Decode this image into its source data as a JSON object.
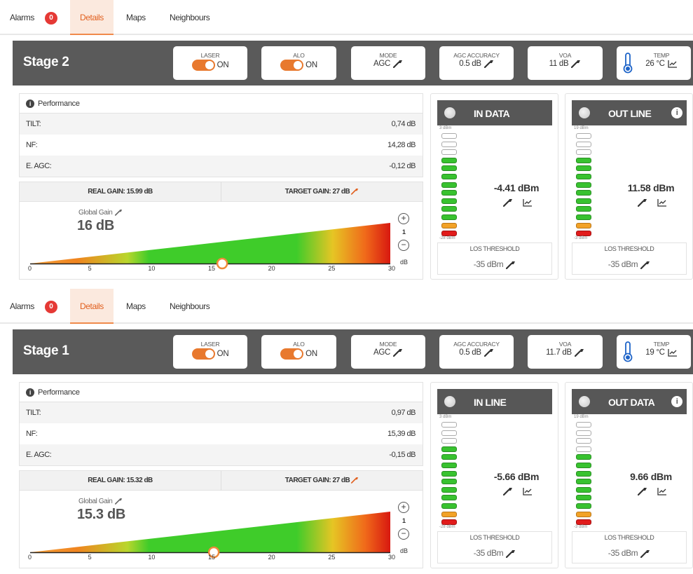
{
  "panels": [
    {
      "tabs": {
        "alarms": "Alarms",
        "alarm_count": "0",
        "details": "Details",
        "maps": "Maps",
        "neighbours": "Neighbours"
      },
      "stage": {
        "title": "Stage 2",
        "laser": {
          "label": "LASER",
          "value": "ON"
        },
        "alo": {
          "label": "ALO",
          "value": "ON"
        },
        "mode": {
          "label": "MODE",
          "value": "AGC"
        },
        "agc_accuracy": {
          "label": "AGC ACCURACY",
          "value": "0.5 dB"
        },
        "voa": {
          "label": "VOA",
          "value": "11 dB"
        },
        "temp": {
          "label": "TEMP",
          "value": "26 °C"
        }
      },
      "performance": {
        "title": "Performance",
        "rows": [
          {
            "label": "TILT:",
            "value": "0,74 dB"
          },
          {
            "label": "NF:",
            "value": "14,28 dB"
          },
          {
            "label": "E. AGC:",
            "value": "-0,12 dB"
          }
        ]
      },
      "gain": {
        "real": "REAL GAIN: 15.99 dB",
        "target": "TARGET GAIN: 27 dB",
        "global_label": "Global Gain",
        "global_value": "16 dB",
        "step": "1",
        "unit": "dB",
        "ticks": [
          "0",
          "5",
          "10",
          "15",
          "20",
          "25",
          "30"
        ],
        "knob_value": 16
      },
      "meters": [
        {
          "title": "IN DATA",
          "scale_top": "3 dBm",
          "scale_bottom": "-28 dBm",
          "reading": "-4.41 dBm",
          "los_label": "LOS THRESHOLD",
          "los_value": "-35 dBm",
          "info": false,
          "level": 10
        },
        {
          "title": "OUT LINE",
          "scale_top": "19 dBm",
          "scale_bottom": "-3 dBm",
          "reading": "11.58 dBm",
          "los_label": "LOS THRESHOLD",
          "los_value": "-35 dBm",
          "info": true,
          "level": 10
        }
      ]
    },
    {
      "tabs": {
        "alarms": "Alarms",
        "alarm_count": "0",
        "details": "Details",
        "maps": "Maps",
        "neighbours": "Neighbours"
      },
      "stage": {
        "title": "Stage 1",
        "laser": {
          "label": "LASER",
          "value": "ON"
        },
        "alo": {
          "label": "ALO",
          "value": "ON"
        },
        "mode": {
          "label": "MODE",
          "value": "AGC"
        },
        "agc_accuracy": {
          "label": "AGC ACCURACY",
          "value": "0.5 dB"
        },
        "voa": {
          "label": "VOA",
          "value": "11.7 dB"
        },
        "temp": {
          "label": "TEMP",
          "value": "19 °C"
        }
      },
      "performance": {
        "title": "Performance",
        "rows": [
          {
            "label": "TILT:",
            "value": "0,97 dB"
          },
          {
            "label": "NF:",
            "value": "15,39 dB"
          },
          {
            "label": "E. AGC:",
            "value": "-0,15 dB"
          }
        ]
      },
      "gain": {
        "real": "REAL GAIN: 15.32 dB",
        "target": "TARGET GAIN: 27 dB",
        "global_label": "Global Gain",
        "global_value": "15.3 dB",
        "step": "1",
        "unit": "dB",
        "ticks": [
          "0",
          "5",
          "10",
          "15",
          "20",
          "25",
          "30"
        ],
        "knob_value": 15.3
      },
      "meters": [
        {
          "title": "IN LINE",
          "scale_top": "3 dBm",
          "scale_bottom": "-28 dBm",
          "reading": "-5.66 dBm",
          "los_label": "LOS THRESHOLD",
          "los_value": "-35 dBm",
          "info": false,
          "level": 10
        },
        {
          "title": "OUT DATA",
          "scale_top": "19 dBm",
          "scale_bottom": "-3 dBm",
          "reading": "9.66 dBm",
          "los_label": "LOS THRESHOLD",
          "los_value": "-35 dBm",
          "info": true,
          "level": 9
        }
      ]
    }
  ],
  "colors": {
    "accent": "#e8792e",
    "header": "#5a5a5a",
    "green": "#38c22f",
    "orange": "#f2a227",
    "red": "#e11b1b",
    "alarm": "#e53935"
  }
}
